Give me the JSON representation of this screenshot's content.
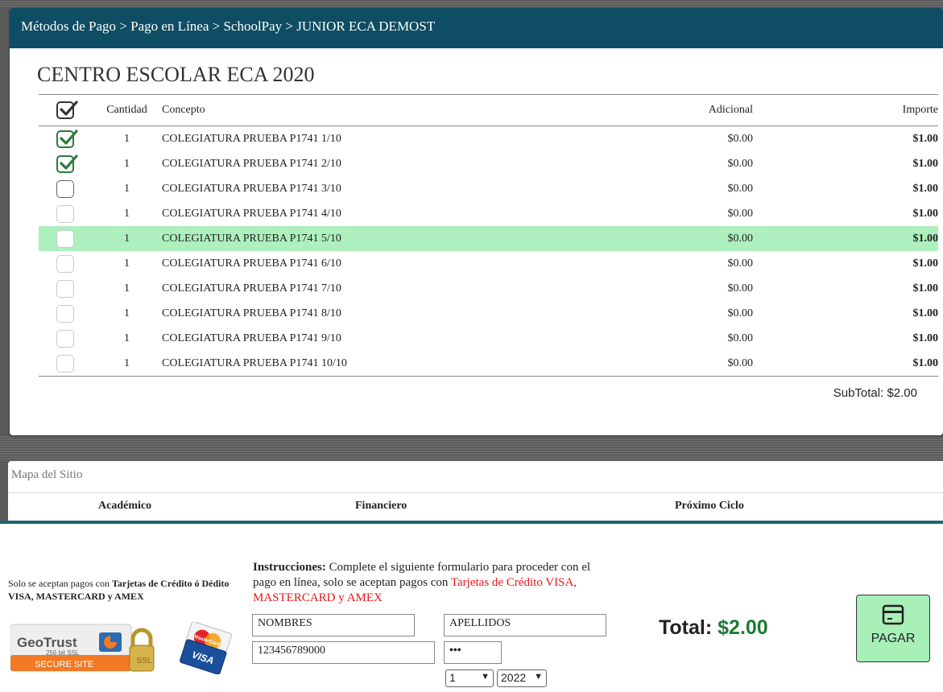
{
  "breadcrumb": "Métodos de Pago > Pago en Línea > SchoolPay > JUNIOR ECA DEMOST",
  "school_name": "CENTRO ESCOLAR ECA 2020",
  "table": {
    "headers": {
      "cantidad": "Cantidad",
      "concepto": "Concepto",
      "adicional": "Adicional",
      "importe": "Importe"
    },
    "rows": [
      {
        "checked": true,
        "style": "green",
        "qty": "1",
        "concept": "COLEGIATURA PRUEBA P1741 1/10",
        "additional": "$0.00",
        "amount": "$1.00"
      },
      {
        "checked": true,
        "style": "green",
        "qty": "1",
        "concept": "COLEGIATURA PRUEBA P1741 2/10",
        "additional": "$0.00",
        "amount": "$1.00"
      },
      {
        "checked": false,
        "style": "dark",
        "qty": "1",
        "concept": "COLEGIATURA PRUEBA P1741 3/10",
        "additional": "$0.00",
        "amount": "$1.00"
      },
      {
        "checked": false,
        "style": "light",
        "qty": "1",
        "concept": "COLEGIATURA PRUEBA P1741 4/10",
        "additional": "$0.00",
        "amount": "$1.00"
      },
      {
        "checked": false,
        "style": "light",
        "qty": "1",
        "concept": "COLEGIATURA PRUEBA P1741 5/10",
        "additional": "$0.00",
        "amount": "$1.00",
        "highlighted": true
      },
      {
        "checked": false,
        "style": "light",
        "qty": "1",
        "concept": "COLEGIATURA PRUEBA P1741 6/10",
        "additional": "$0.00",
        "amount": "$1.00"
      },
      {
        "checked": false,
        "style": "light",
        "qty": "1",
        "concept": "COLEGIATURA PRUEBA P1741 7/10",
        "additional": "$0.00",
        "amount": "$1.00"
      },
      {
        "checked": false,
        "style": "light",
        "qty": "1",
        "concept": "COLEGIATURA PRUEBA P1741 8/10",
        "additional": "$0.00",
        "amount": "$1.00"
      },
      {
        "checked": false,
        "style": "light",
        "qty": "1",
        "concept": "COLEGIATURA PRUEBA P1741 9/10",
        "additional": "$0.00",
        "amount": "$1.00"
      },
      {
        "checked": false,
        "style": "light",
        "qty": "1",
        "concept": "COLEGIATURA PRUEBA P1741 10/10",
        "additional": "$0.00",
        "amount": "$1.00"
      }
    ],
    "subtotal_label": "SubTotal:",
    "subtotal_value": "$2.00"
  },
  "sitemap": {
    "title": "Mapa del Sitio",
    "columns": [
      "Académico",
      "Financiero",
      "Próximo Ciclo"
    ]
  },
  "payment": {
    "note_prefix": "Solo se aceptan pagos con ",
    "note_bold": "Tarjetas de Crédito ó Dédito VISA, MASTERCARD y AMEX",
    "instructions_label": "Instrucciones:",
    "instructions_text": " Complete el siguiente formulario para proceder con el pago en línea, solo se aceptan pagos con ",
    "instructions_red": "Tarjetas de Crédito VISA, MASTERCARD y AMEX",
    "first_name": "NOMBRES",
    "last_name": "APELLIDOS",
    "card_number": "123456789000",
    "cvv": "•••",
    "month": "1",
    "year": "2022",
    "total_label": "Total:",
    "total_value": "$2.00",
    "pay_button": "PAGAR",
    "badge_brand": "GeoTrust",
    "badge_bits": "256 bit SSL",
    "badge_secure": "SECURE SITE",
    "card_brands": [
      "MasterCard",
      "VISA"
    ]
  },
  "colors": {
    "topbar": "#0e4d63",
    "highlight_row": "#aef0bd",
    "check_green": "#2b7a3d",
    "total_green": "#1b7a34",
    "pay_button": "#a8f0b8",
    "red_text": "#e8161b"
  }
}
